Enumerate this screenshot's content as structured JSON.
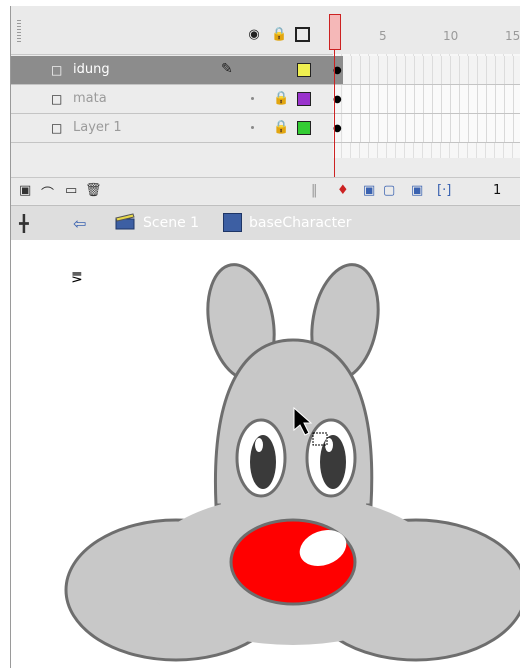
{
  "timeline": {
    "header_icons": [
      "eye-icon",
      "lock-icon",
      "outline-icon"
    ],
    "frame_numbers": [
      "5",
      "10",
      "15"
    ],
    "layers": [
      {
        "name": "idung",
        "selected": true,
        "color": "#f0f050",
        "state_icon": "pencil-icon"
      },
      {
        "name": "mata",
        "selected": false,
        "color": "#9933cc",
        "state_icon": "lock-icon"
      },
      {
        "name": "Layer 1",
        "selected": false,
        "color": "#33cc33",
        "state_icon": "lock-icon"
      }
    ],
    "current_frame": "1",
    "toolbar_icons": [
      "insert-layer-icon",
      "add-motion-guide-icon",
      "insert-folder-icon",
      "delete-layer-icon",
      "center-frame-icon",
      "onion-skin-icon",
      "onion-outlines-icon",
      "edit-multiple-frames-icon",
      "modify-markers-icon"
    ]
  },
  "editbar": {
    "scene_label": "Scene 1",
    "symbol_label": "baseCharacter",
    "bar_color": "#dedede"
  },
  "stage": {
    "character_fill": "#c8c8c8",
    "character_stroke": "#6e6e6e",
    "nose_color": "#ff0000"
  }
}
